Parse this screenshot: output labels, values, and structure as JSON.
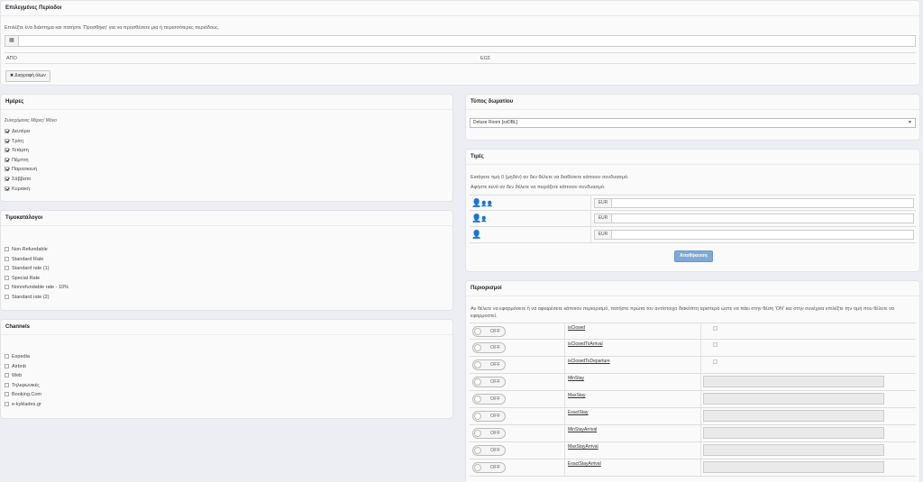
{
  "periods": {
    "title": "Επιλεγμένες Περίοδοι",
    "help": "Επιλέξτε ένα διάστημα και πατήστε 'Προσθήκη' για να προσθέσετε μια ή περισσότερες περιόδους.",
    "calendar_glyph": "▦",
    "col_from": "ΑΠΟ",
    "col_to": "ΕΩΣ",
    "delete_all": "✖ Διαγραφή όλων"
  },
  "days": {
    "title": "Ημέρες",
    "subtitle": "Συνεχόμενες Μέρες/ Μόνο",
    "items": [
      {
        "label": "Δευτέρα",
        "checked": true
      },
      {
        "label": "Τρίτη",
        "checked": true
      },
      {
        "label": "Τετάρτη",
        "checked": true
      },
      {
        "label": "Πέμπτη",
        "checked": true
      },
      {
        "label": "Παρασκευή",
        "checked": true
      },
      {
        "label": "Σάββατο",
        "checked": true
      },
      {
        "label": "Κυριακή",
        "checked": true
      }
    ]
  },
  "rateplans": {
    "title": "Τιμοκατάλογοι",
    "items": [
      {
        "label": "Non Refundable",
        "checked": false
      },
      {
        "label": "Standard Rate",
        "checked": false
      },
      {
        "label": "Standard rate (1)",
        "checked": false
      },
      {
        "label": "Special Rate",
        "checked": false
      },
      {
        "label": "Nonrefundable rate - 10%",
        "checked": false
      },
      {
        "label": "Standard rate (2)",
        "checked": false
      }
    ]
  },
  "channels": {
    "title": "Channels",
    "items": [
      {
        "label": "Expedia",
        "checked": false
      },
      {
        "label": "Airbnb",
        "checked": false
      },
      {
        "label": "Web",
        "checked": false
      },
      {
        "label": "Τηλεφωνικές",
        "checked": false
      },
      {
        "label": "Booking.Com",
        "checked": false
      },
      {
        "label": "e-kyklades.gr",
        "checked": false
      }
    ]
  },
  "roomtype": {
    "title": "Τύπος δωματίου",
    "selected": "Deluxe Room [sxDBL]",
    "caret": "▼"
  },
  "prices": {
    "title": "Τιμές",
    "help1": "Εισάγετε τιμή 0 (μηδέν) αν δεν θέλετε να διαθέσετε κάποιον συνδυασμό.",
    "help2": "Αφήστε κενό αν δεν θέλετε να πειράξετε κάποιον συνδυασμό.",
    "rows": [
      {
        "icons": "👤",
        "small": "👤👤",
        "currency": "EUR"
      },
      {
        "icons": "👤",
        "small": "👤",
        "currency": "EUR"
      },
      {
        "icons": "👤",
        "small": "",
        "currency": "EUR"
      }
    ],
    "save": "Αποθήκευση"
  },
  "restrictions": {
    "title": "Περιορισμοί",
    "help": "Αν θέλετε να εφαρμόσετε ή να αφαιρέσετε κάποιον περιορισμό, πατήστε πρώτα τον αντίστοιχο διακόπτη αριστερά ώστε να πάει στην θέση 'ON' και στην συνέχεια επιλέξτε την τιμή που θέλετε να εφαρμοστεί.",
    "toggle_label": "OFF",
    "rows": [
      {
        "name": "isClosed",
        "kind": "checkbox"
      },
      {
        "name": "isClosedToArrival",
        "kind": "checkbox"
      },
      {
        "name": "isClosedToDeparture",
        "kind": "checkbox"
      },
      {
        "name": "MinStay",
        "kind": "input"
      },
      {
        "name": "MaxStay",
        "kind": "input"
      },
      {
        "name": "ExactStay",
        "kind": "input"
      },
      {
        "name": "MinStayArrival",
        "kind": "input"
      },
      {
        "name": "MaxStayArrival",
        "kind": "input"
      },
      {
        "name": "ExactStayArrival",
        "kind": "input"
      }
    ]
  }
}
